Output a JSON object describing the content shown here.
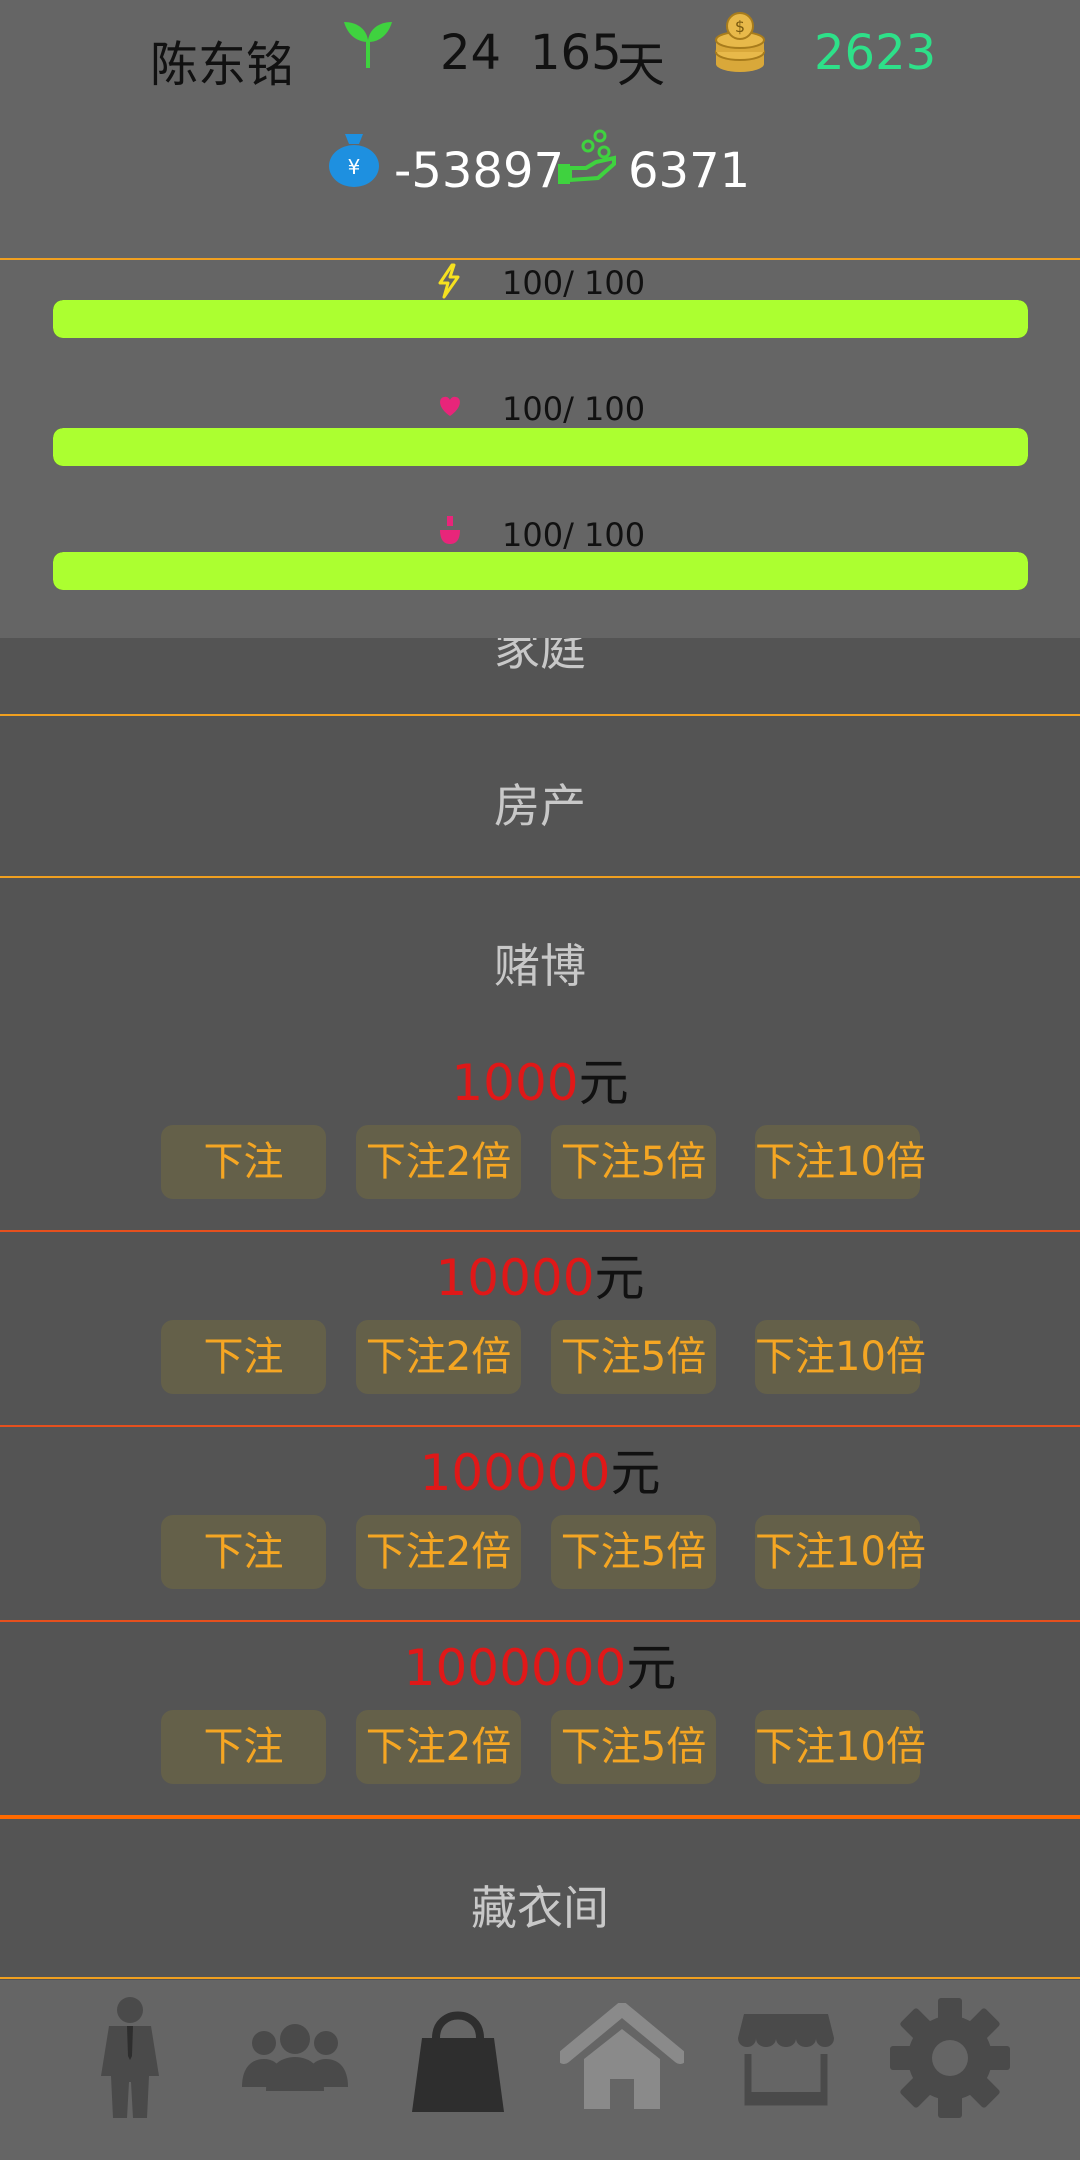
{
  "header": {
    "player_name": "陈东铭",
    "age": "24",
    "days": "165",
    "days_unit": "天",
    "coins": "2623",
    "money": "-53897",
    "income": "6371",
    "icons": {
      "age": "sprout-icon",
      "coins": "coin-stack-icon",
      "money": "money-bag-icon",
      "income": "hand-coins-icon"
    }
  },
  "stats": [
    {
      "icon": "lightning-icon",
      "label": "100/ 100",
      "value": 100,
      "max": 100
    },
    {
      "icon": "heart-icon",
      "label": "100/ 100",
      "value": 100,
      "max": 100
    },
    {
      "icon": "flask-icon",
      "label": "100/ 100",
      "value": 100,
      "max": 100
    }
  ],
  "sections": {
    "family": "家庭",
    "property": "房产",
    "gambling": "赌博",
    "wardrobe": "藏衣间"
  },
  "gambling": {
    "unit": "元",
    "rows": [
      {
        "amount": "1000"
      },
      {
        "amount": "10000"
      },
      {
        "amount": "100000"
      },
      {
        "amount": "1000000"
      }
    ],
    "buttons": [
      "下注",
      "下注2倍",
      "下注5倍",
      "下注10倍"
    ]
  },
  "nav": [
    {
      "icon": "person-icon"
    },
    {
      "icon": "group-icon"
    },
    {
      "icon": "shopping-bag-icon"
    },
    {
      "icon": "home-icon"
    },
    {
      "icon": "store-icon"
    },
    {
      "icon": "gear-icon"
    }
  ],
  "colors": {
    "background": "#545454",
    "panel": "#656565",
    "bar_fill": "#acff30",
    "accent_orange": "#f0a020",
    "amount_red": "#e01818",
    "button_text": "#f5a623",
    "coins_green": "#2ee089"
  }
}
